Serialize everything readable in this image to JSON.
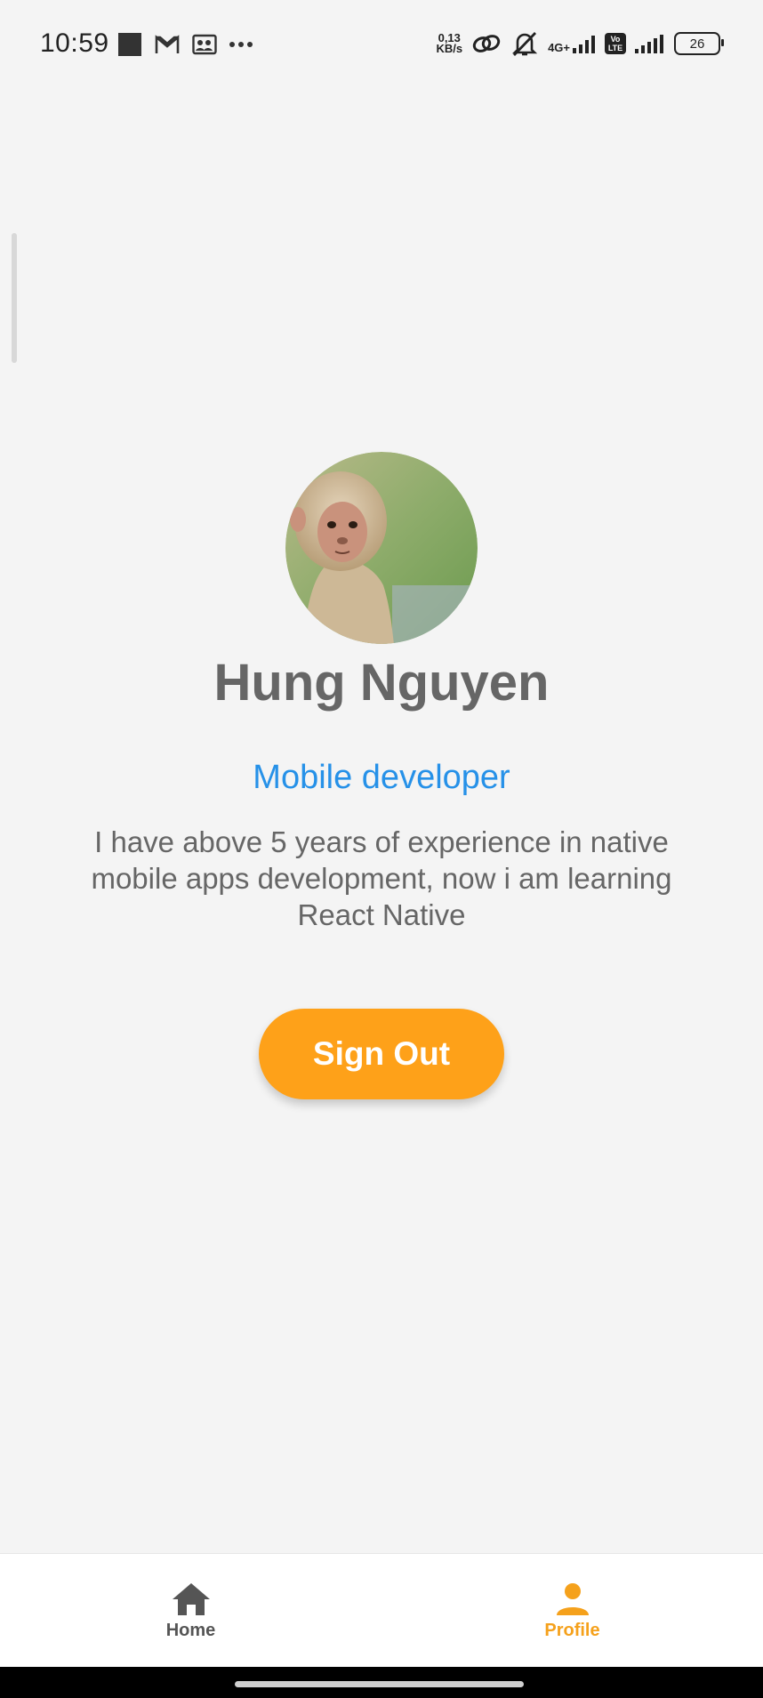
{
  "status_bar": {
    "time": "10:59",
    "net_speed_value": "0,13",
    "net_speed_unit": "KB/s",
    "network_label": "4G+",
    "volte_label": "Vo LTE",
    "battery_level": "26"
  },
  "profile": {
    "name": "Hung Nguyen",
    "title": "Mobile developer",
    "bio": "I have above 5 years of experience in native mobile apps development, now i am learning React Native"
  },
  "actions": {
    "sign_out_label": "Sign Out"
  },
  "bottom_nav": {
    "items": [
      {
        "label": "Home",
        "icon": "home-icon",
        "active": false
      },
      {
        "label": "Profile",
        "icon": "person-icon",
        "active": true
      }
    ]
  },
  "colors": {
    "accent": "#fea119",
    "title_blue": "#2691e8",
    "text_gray": "#666666",
    "background": "#f4f4f4"
  }
}
